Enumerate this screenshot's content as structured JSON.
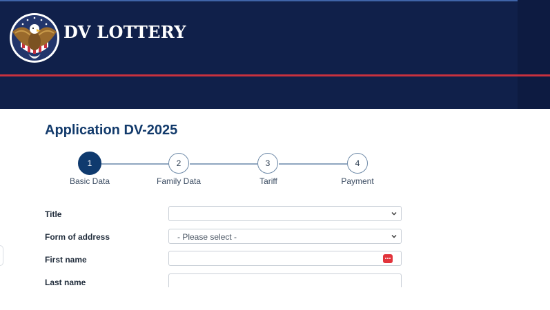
{
  "header": {
    "brand": "DV LOTTERY",
    "colors": {
      "navy": "#10204a",
      "accent_red": "#c8313e"
    }
  },
  "page": {
    "title": "Application DV-2025"
  },
  "steps": [
    {
      "number": "1",
      "label": "Basic Data",
      "active": true
    },
    {
      "number": "2",
      "label": "Family Data",
      "active": false
    },
    {
      "number": "3",
      "label": "Tariff",
      "active": false
    },
    {
      "number": "4",
      "label": "Payment",
      "active": false
    }
  ],
  "form": {
    "title": {
      "label": "Title",
      "value": ""
    },
    "form_of_address": {
      "label": "Form of address",
      "value": "- Please select -"
    },
    "first_name": {
      "label": "First name",
      "value": "",
      "icon": "password-manager-icon"
    },
    "last_name": {
      "label": "Last name",
      "value": ""
    }
  }
}
